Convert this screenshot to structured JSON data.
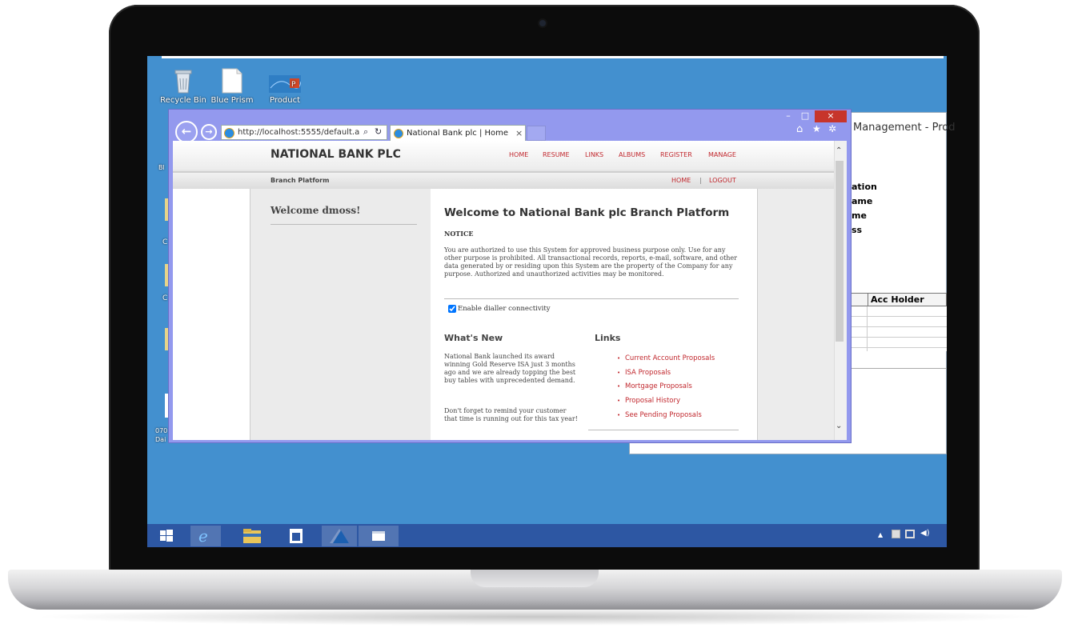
{
  "desktop": {
    "icons": [
      {
        "label": "Recycle Bin",
        "icon": "recycle-bin-icon"
      },
      {
        "label": "Blue Prism",
        "icon": "document-icon"
      },
      {
        "label": "Product",
        "icon": "product-icon"
      }
    ],
    "edge_labels": [
      "Bl",
      "C",
      "C",
      "070",
      "Dai"
    ]
  },
  "background_app": {
    "title": "Management - Prod",
    "fields": [
      "ation",
      "ame",
      "me",
      "ss"
    ],
    "table_header": "Acc Holder"
  },
  "browser": {
    "address": "http://localhost:5555/default.a",
    "address_host": "localhost",
    "tab_title": "National Bank plc | Home",
    "tab_close": "×",
    "buttons": {
      "minimize": "–",
      "maximize": "□",
      "close": "×"
    }
  },
  "site": {
    "brand": "NATIONAL BANK PLC",
    "nav": [
      "HOME",
      "RESUME",
      "LINKS",
      "ALBUMS",
      "REGISTER",
      "MANAGE"
    ],
    "subbar_label": "Branch Platform",
    "sub_nav": {
      "home": "HOME",
      "separator": "|",
      "logout": "LOGOUT"
    },
    "welcome": "Welcome dmoss!",
    "main_title": "Welcome to National Bank plc Branch Platform",
    "notice_heading": "NOTICE",
    "notice_text": "You are authorized to use this System for approved business purpose only. Use for any other purpose is prohibited. All transactional records, reports, e-mail, software, and other data generated by or residing upon this System are the property of the Company for any purpose. Authorized and unauthorized activities may be monitored.",
    "dialler_label": "Enable dialler connectivity",
    "dialler_checked": true,
    "whats_new_heading": "What's New",
    "whats_new_p1": "National Bank launched its award winning Gold Reserve ISA just 3 months ago and we are already topping the best buy tables with unprecedented demand.",
    "whats_new_p2": "Don't forget to remind your customer that time is running out for this tax year!",
    "links_heading": "Links",
    "links": [
      "Current Account Proposals",
      "ISA Proposals",
      "Mortgage Proposals",
      "Proposal History",
      "See Pending Proposals"
    ]
  },
  "colors": {
    "accent": "#c1272d",
    "desktop": "#4390cf",
    "taskbar": "#2d57a3",
    "ie_frame": "#9399ee"
  }
}
